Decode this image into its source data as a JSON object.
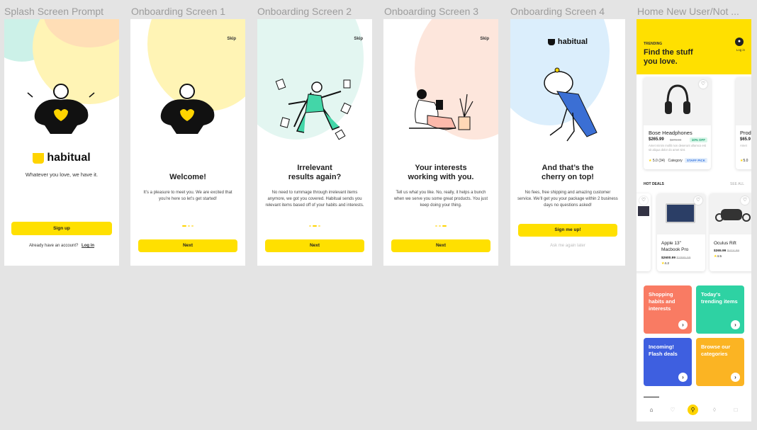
{
  "frames": {
    "splash": {
      "label": "Splash Screen Prompt"
    },
    "ob1": {
      "label": "Onboarding Screen 1"
    },
    "ob2": {
      "label": "Onboarding Screen 2"
    },
    "ob3": {
      "label": "Onboarding Screen 3"
    },
    "ob4": {
      "label": "Onboarding Screen 4"
    },
    "home": {
      "label": "Home New User/Not ..."
    }
  },
  "brand": {
    "name": "habitual",
    "tagline": "Whatever you love, we have it.",
    "yellow": "#ffd400"
  },
  "splash": {
    "signup": "Sign up",
    "have_account": "Already have an account?",
    "login": "Log in"
  },
  "ob1": {
    "skip": "Skip",
    "title": "Welcome!",
    "body": "It’s a pleasure to meet you. We are excited that you’re here so let’s get started!",
    "next": "Next"
  },
  "ob2": {
    "skip": "Skip",
    "title_1": "Irrelevant",
    "title_2": "results again?",
    "body": "No need to rummage through irrelevant items anymore, we got you covered. Habitual sends you relevant items based off of your habits and interests.",
    "next": "Next"
  },
  "ob3": {
    "skip": "Skip",
    "title_1": "Your interests",
    "title_2": "working with you.",
    "body": "Tell us what you like. No, really, it helps a bunch when we serve you some great products. You just keep doing your thing.",
    "next": "Next"
  },
  "ob4": {
    "title_1": "And that’s the",
    "title_2": "cherry on top!",
    "body": "No fees, free shipping and amazing customer service. We’ll get you your package within 2 business days no questions asked!",
    "signup": "Sign me up!",
    "later": "Ask me again later"
  },
  "home": {
    "trending": "TRENDING",
    "headline_1": "Find the stuff",
    "headline_2": "you love.",
    "login": "Log in",
    "product": {
      "name": "Bose Headphones",
      "price": "$265.99",
      "old_price": "$379.99",
      "discount": "10% OFF",
      "desc": "Amet minim mollit non deserunt ullamco est sit aliqua dolor do amet sint.",
      "rating": "5.0",
      "reviews": "(34)",
      "category": "Category",
      "badge": "STAFF PICK"
    },
    "product2": {
      "name": "Prod",
      "price": "$65.9",
      "desc": "Amet",
      "rating": "5.0"
    },
    "hot_deals": "HOT DEALS",
    "see_all": "SEE ALL",
    "deals": [
      {
        "name_1": "Apple 13\"",
        "name_2": "Macbook Pro",
        "price": "$2600.99",
        "old": "$2999.99",
        "rating": "4.2"
      },
      {
        "name_1": "Oculus Rift",
        "name_2": "",
        "price": "$365.99",
        "old": "$474.99",
        "rating": "4.5"
      }
    ],
    "categories": [
      {
        "label": "Shopping habits and interests",
        "color": "#f97b63"
      },
      {
        "label": "Today's trending items",
        "color": "#2ed2a3"
      },
      {
        "label": "Incoming! Flash deals",
        "color": "#3e5fe0"
      },
      {
        "label": "Browse our categories",
        "color": "#fbb423"
      }
    ],
    "tabs": [
      "home-icon",
      "heart-icon",
      "search-icon",
      "tag-icon",
      "bag-icon"
    ]
  }
}
